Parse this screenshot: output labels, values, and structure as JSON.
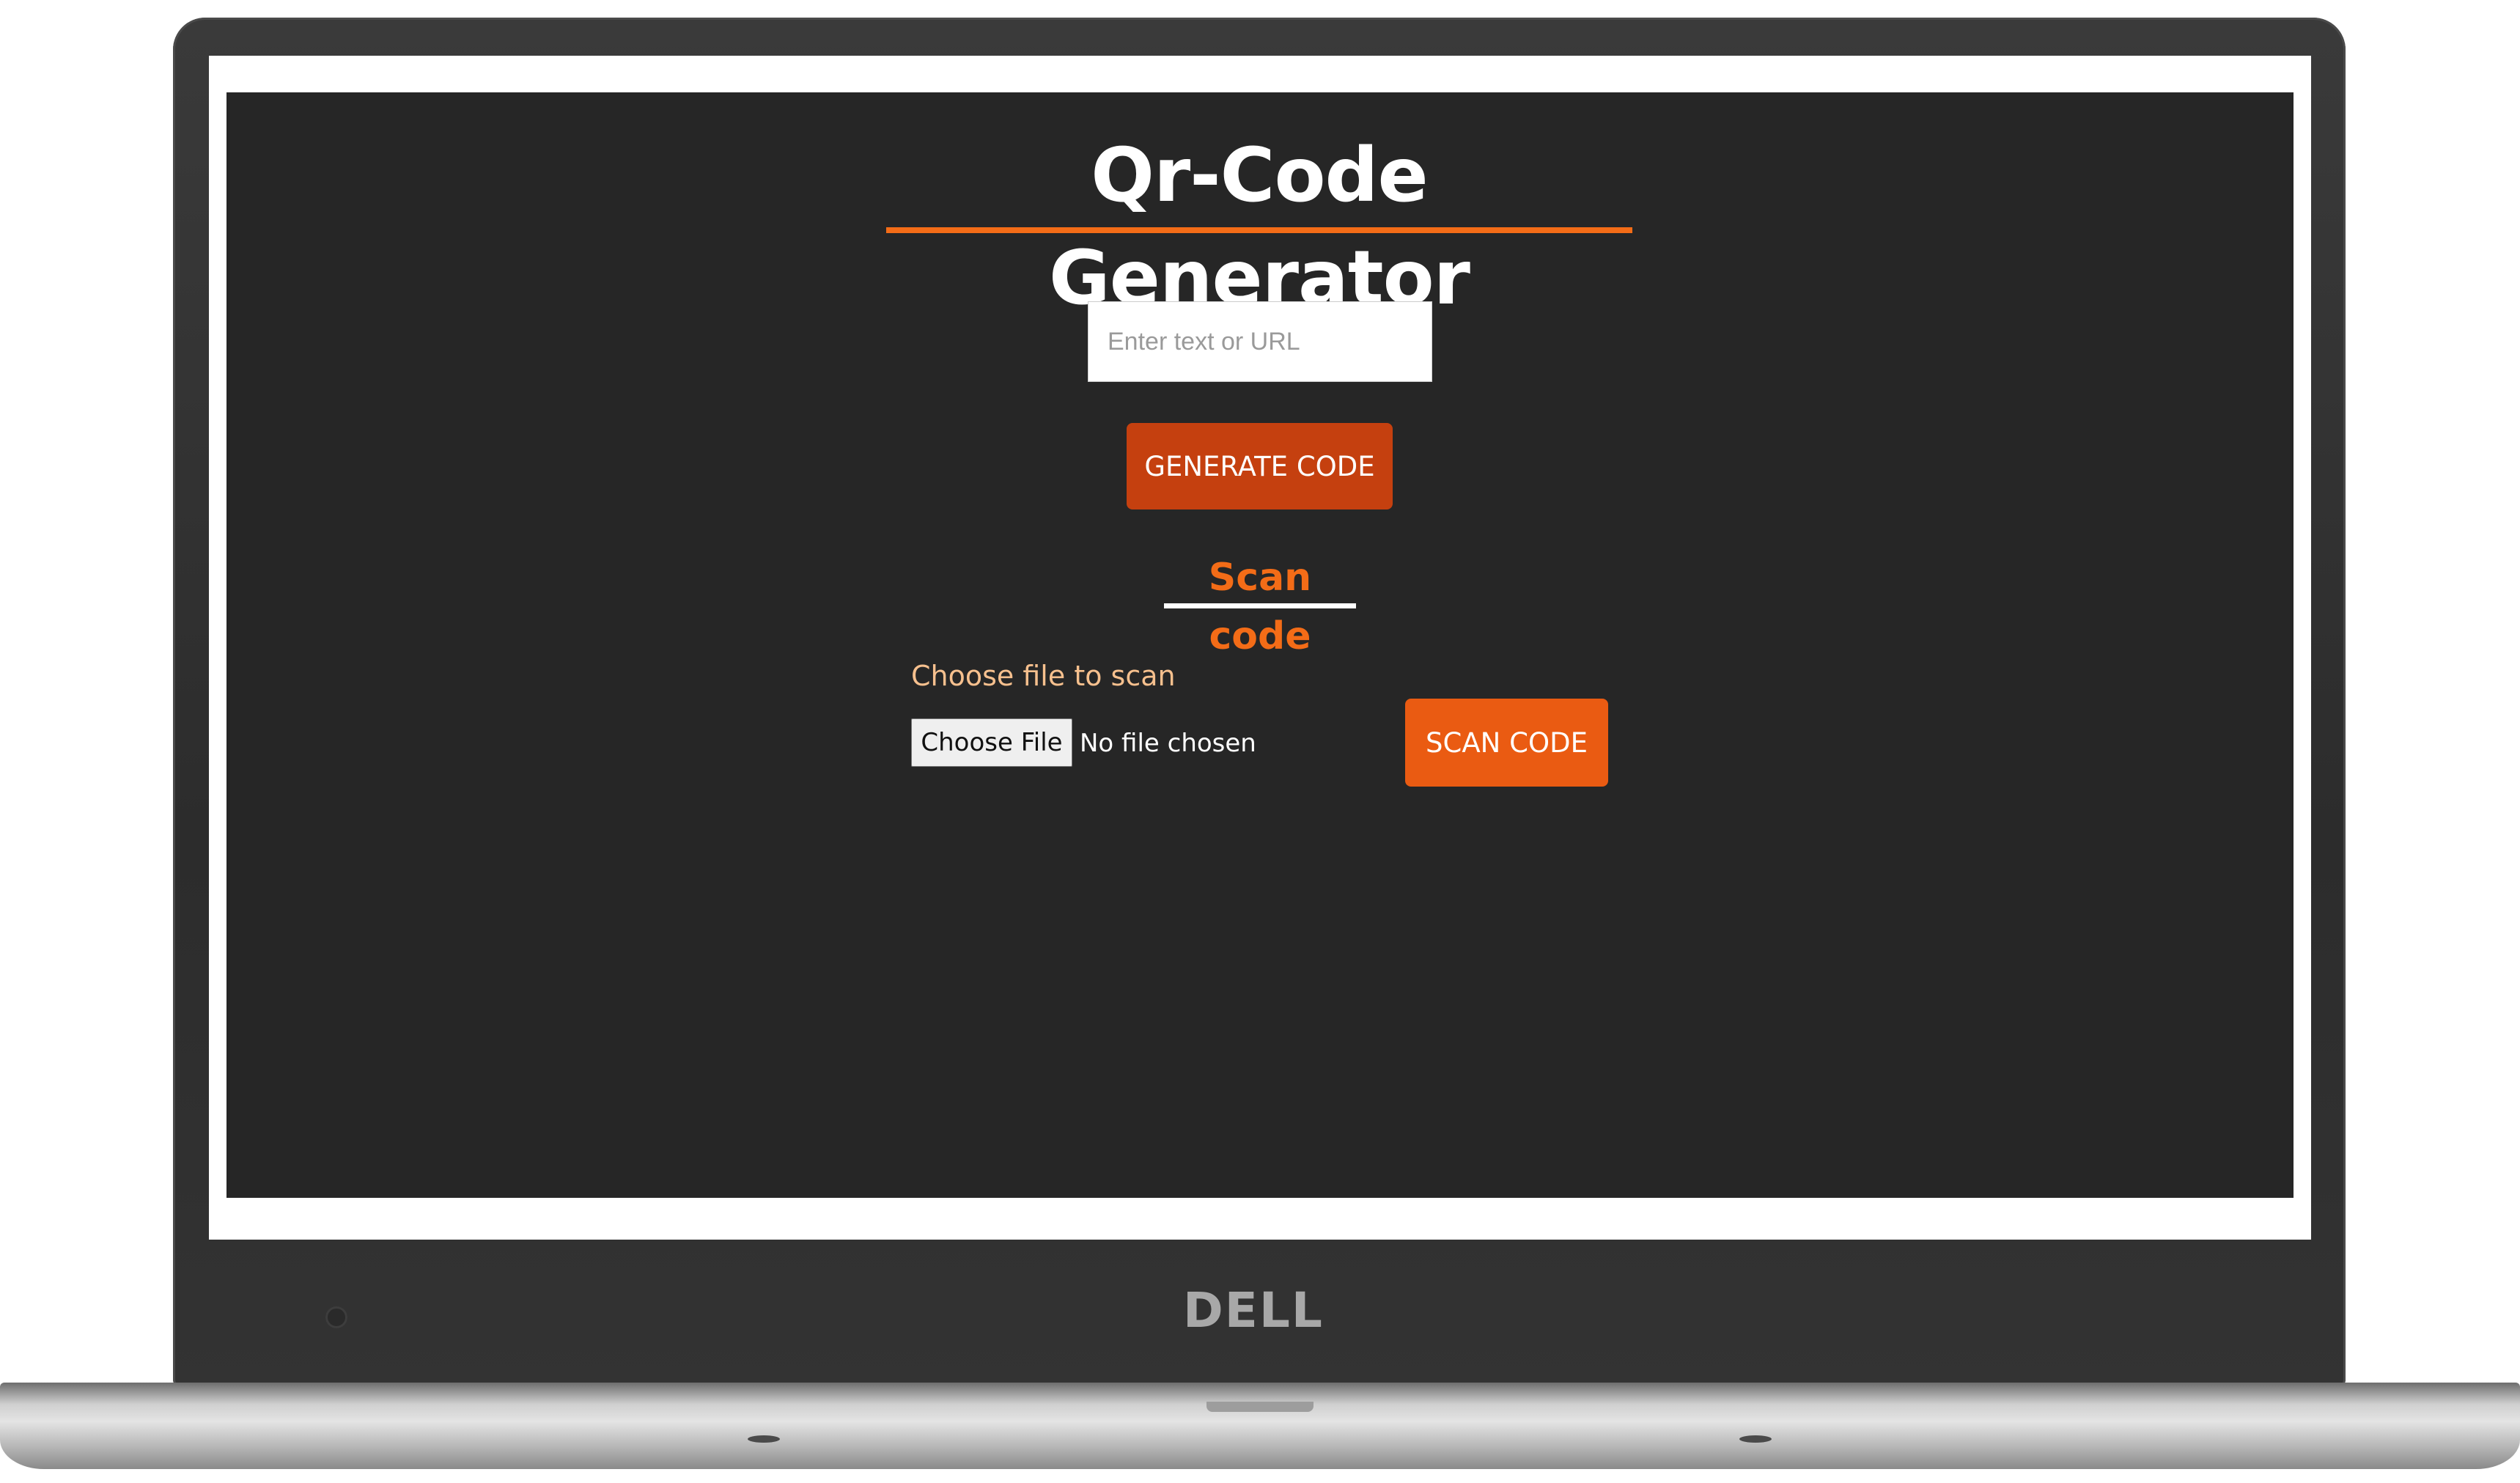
{
  "app": {
    "title": "Qr-Code Generator"
  },
  "generator": {
    "input_placeholder": "Enter text or URL",
    "input_value": "",
    "button_label": "GENERATE CODE"
  },
  "scanner": {
    "heading": "Scan code",
    "file_label": "Choose file to scan",
    "file_button_label": "Choose File",
    "file_status": "No file chosen",
    "button_label": "SCAN CODE"
  },
  "device": {
    "brand": "DELL"
  },
  "colors": {
    "accent": "#f36c17",
    "generate_button": "#c5400f",
    "scan_button": "#ea5b12",
    "background": "#262626",
    "label": "#f6c08e"
  }
}
